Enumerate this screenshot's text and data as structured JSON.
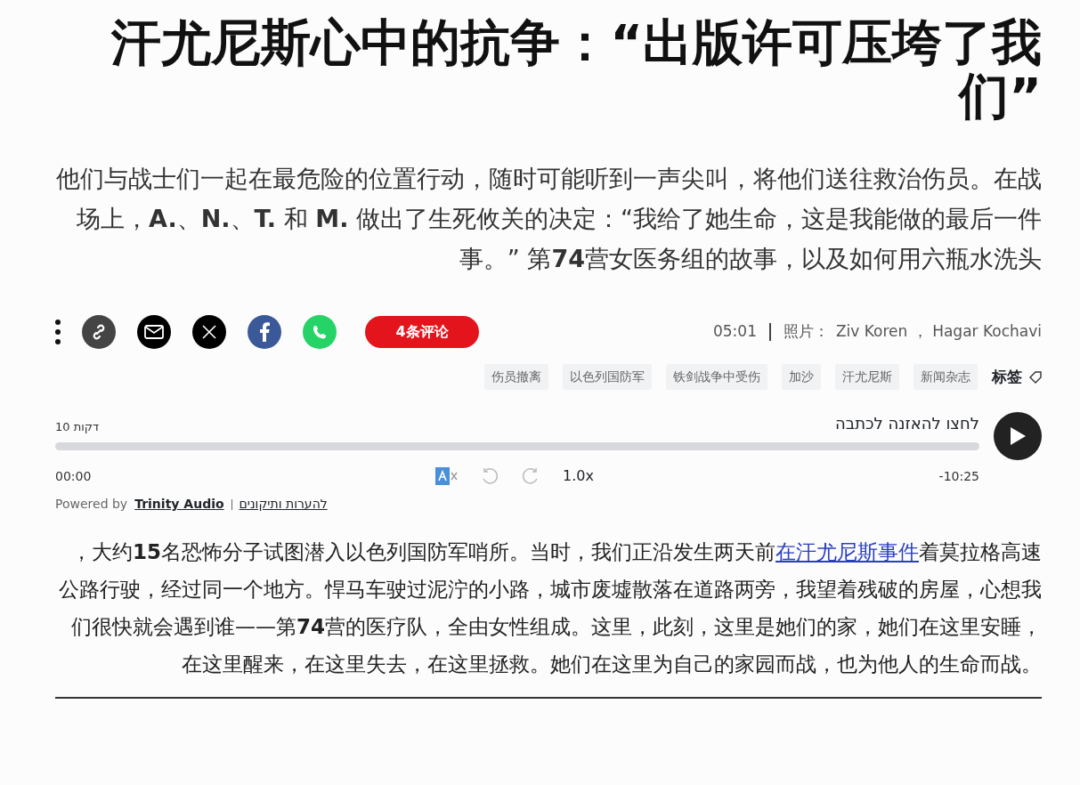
{
  "title": "汗尤尼斯心中的抗争：“出版许可压垮了我们”",
  "lead": "他们与战士们一起在最危险的位置行动，随时可能听到一声尖叫，将他们送往救治伤员。在战场上，**A.**、**N.**、**T.** 和 **M.** 做出了生死攸关的决定：“我给了她生命，这是我能做的最后一件事。” 第**74**营女医务组的故事，以及如何用六瓶水洗头",
  "share": [
    {
      "kind": "link"
    },
    {
      "kind": "email"
    },
    {
      "kind": "x"
    },
    {
      "kind": "facebook"
    },
    {
      "kind": "whatsapp"
    }
  ],
  "comments_button": "4条评论",
  "meta": {
    "time": "05:01",
    "photo_label": "照片：",
    "photographers": "Ziv Koren ， Hagar Kochavi"
  },
  "tags": [
    "伤员撤离",
    "以色列国防军",
    "铁剑战争中受伤",
    "加沙",
    "汗尤尼斯",
    "新闻杂志"
  ],
  "tags_label": "标签",
  "audio": {
    "duration": "10 דקות",
    "prompt": "לחצו להאזנה לכתבה",
    "current": "00:00",
    "speed": "1.0x",
    "remaining": "-10:25",
    "powered_by": "Powered by",
    "brand": "Trinity Audio",
    "feedback": "להערות ותיקונים"
  },
  "body": {
    "before": "，大约**15**名恐怖分子试图潜入以色列国防军哨所。当时，我们正沿发生两天前",
    "link": "在汗尤尼斯事件",
    "after": "着莫拉格高速公路行驶，经过同一个地方。悍马车驶过泥泞的小路，城市废墟散落在道路两旁，我望着残破的房屋，心想我们很快就会遇到谁——第**74**营的医疗队，全由女性组成。这里，此刻，这里是她们的家，她们在这里安睡，在这里醒来，在这里失去，在这里拯救。她们在这里为自己的家园而战，也为他人的生命而战。"
  }
}
